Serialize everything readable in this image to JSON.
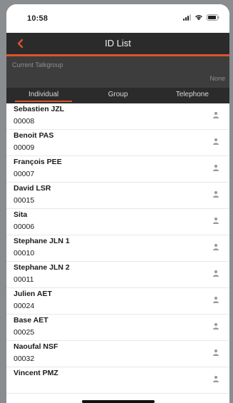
{
  "status_bar": {
    "time": "10:58"
  },
  "nav": {
    "title": "ID List",
    "back_icon": "chevron-left-icon"
  },
  "talkgroup": {
    "label": "Current Talkgroup",
    "value": "None"
  },
  "tabs": [
    {
      "label": "Individual",
      "active": true
    },
    {
      "label": "Group",
      "active": false
    },
    {
      "label": "Telephone",
      "active": false
    }
  ],
  "contacts": [
    {
      "name": "Sebastien JZL",
      "id": "00008"
    },
    {
      "name": "Benoit PAS",
      "id": "00009"
    },
    {
      "name": "François PEE",
      "id": "00007"
    },
    {
      "name": "David LSR",
      "id": "00015"
    },
    {
      "name": "Sita",
      "id": "00006"
    },
    {
      "name": "Stephane JLN 1",
      "id": "00010"
    },
    {
      "name": "Stephane JLN 2",
      "id": "00011"
    },
    {
      "name": "Julien AET",
      "id": "00024"
    },
    {
      "name": "Base AET",
      "id": "00025"
    },
    {
      "name": "Naoufal NSF",
      "id": "00032"
    },
    {
      "name": "Vincent PMZ",
      "id": ""
    }
  ],
  "colors": {
    "accent": "#d9552b",
    "header_bg": "#2b2b2b",
    "talkgroup_bg": "#3d3d3d"
  }
}
